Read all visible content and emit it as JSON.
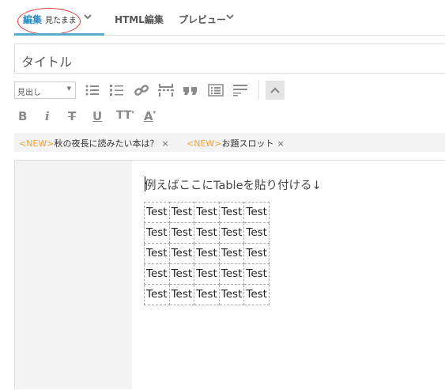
{
  "tabs": {
    "edit_label": "編集",
    "edit_mode": "見たまま",
    "html_label": "HTML編集",
    "preview_label": "プレビュー"
  },
  "title_field": {
    "value": "タイトル"
  },
  "toolbar": {
    "heading_select": "見出し",
    "icons": [
      "bullet-list-icon",
      "numbered-list-icon",
      "link-icon",
      "page-break-icon",
      "quote-icon",
      "toc-icon",
      "more-icon"
    ]
  },
  "format_bar": {
    "bold": "B",
    "italic": "i",
    "strike": "T",
    "underline": "U",
    "size": "TT",
    "color": "A"
  },
  "tag_suggestions": [
    {
      "new": "<NEW>",
      "text": "秋の夜長に読みたい本は？",
      "close": "×"
    },
    {
      "new": "<NEW>",
      "text": "お題スロット",
      "close": "×"
    }
  ],
  "editor": {
    "intro_text": "例えばここにTableを貼り付ける↓",
    "table": [
      [
        "Test",
        "Test",
        "Test",
        "Test",
        "Test"
      ],
      [
        "Test",
        "Test",
        "Test",
        "Test",
        "Test"
      ],
      [
        "Test",
        "Test",
        "Test",
        "Test",
        "Test"
      ],
      [
        "Test",
        "Test",
        "Test",
        "Test",
        "Test"
      ],
      [
        "Test",
        "Test",
        "Test",
        "Test",
        "Test"
      ]
    ]
  },
  "colors": {
    "accent": "#2b8cc4",
    "tab_underline": "#5aaccc",
    "annotation_ring": "#dd3333",
    "new_tag": "#f0a03c"
  }
}
